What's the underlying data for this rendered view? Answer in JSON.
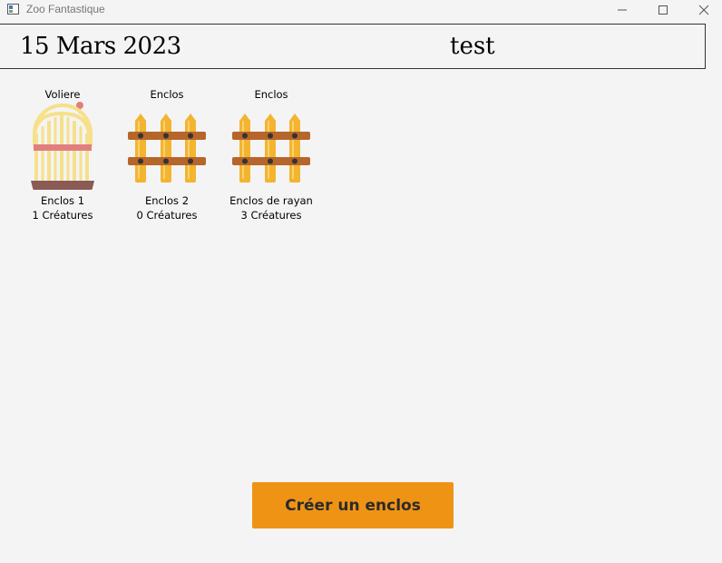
{
  "window": {
    "title": "Zoo Fantastique"
  },
  "header": {
    "date": "15 Mars 2023",
    "user": "test"
  },
  "enclosures": [
    {
      "type": "Voliere",
      "name": "Enclos 1",
      "count": "1 Créatures",
      "icon": "birdcage-icon"
    },
    {
      "type": "Enclos",
      "name": "Enclos 2",
      "count": "0 Créatures",
      "icon": "fence-icon"
    },
    {
      "type": "Enclos",
      "name": "Enclos de rayan",
      "count": "3 Créatures",
      "icon": "fence-icon"
    }
  ],
  "actions": {
    "create_label": "Créer un enclos"
  },
  "colors": {
    "background": "#f4f4f4",
    "button": "#ef9315",
    "fence": "#f3b431",
    "fence_rail": "#b6662a",
    "cage": "#f6e08a",
    "cage_band": "#e07f7f",
    "cage_base": "#8a5a55"
  }
}
